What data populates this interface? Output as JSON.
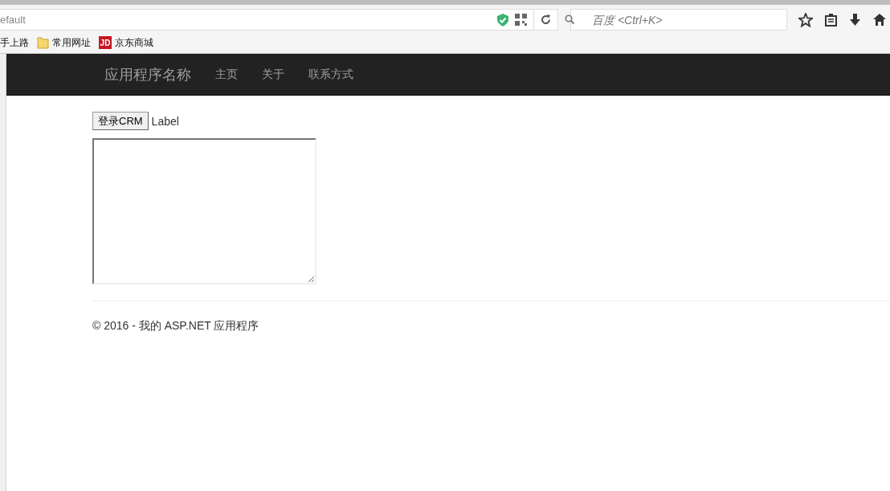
{
  "browser": {
    "address": "efault",
    "search_placeholder": "百度 <Ctrl+K>",
    "bookmarks": [
      {
        "label": "手上路",
        "kind": "plain"
      },
      {
        "label": "常用网址",
        "kind": "folder"
      },
      {
        "label": "京东商城",
        "kind": "logo",
        "icon_text": "JD"
      }
    ]
  },
  "navbar": {
    "brand": "应用程序名称",
    "items": [
      "主页",
      "关于",
      "联系方式"
    ]
  },
  "form": {
    "button": "登录CRM",
    "label": "Label"
  },
  "footer": "© 2016 - 我的 ASP.NET 应用程序"
}
